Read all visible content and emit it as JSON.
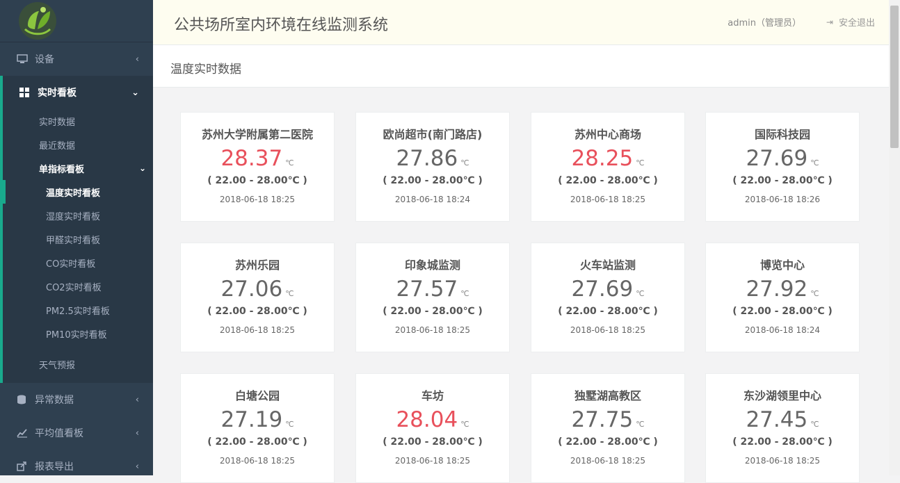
{
  "header": {
    "title": "公共场所室内环境在线监测系统",
    "user": "admin（管理员）",
    "logout": "安全退出"
  },
  "page": {
    "heading": "温度实时数据"
  },
  "sidebar": {
    "devices": "设备",
    "realtime_board": "实时看板",
    "realtime_data": "实时数据",
    "recent_data": "最近数据",
    "single_board": "单指标看板",
    "third": [
      "温度实时看板",
      "湿度实时看板",
      "甲醛实时看板",
      "CO实时看板",
      "CO2实时看板",
      "PM2.5实时看板",
      "PM10实时看板"
    ],
    "weather": "天气预报",
    "abnormal": "异常数据",
    "average": "平均值看板",
    "export": "报表导出"
  },
  "cards": [
    {
      "name": "苏州大学附属第二医院",
      "value": "28.37",
      "unit": "℃",
      "range": "( 22.00 - 28.00℃ )",
      "time": "2018-06-18 18:25",
      "alert": true
    },
    {
      "name": "欧尚超市(南门路店)",
      "value": "27.86",
      "unit": "℃",
      "range": "( 22.00 - 28.00℃ )",
      "time": "2018-06-18 18:24",
      "alert": false
    },
    {
      "name": "苏州中心商场",
      "value": "28.25",
      "unit": "℃",
      "range": "( 22.00 - 28.00℃ )",
      "time": "2018-06-18 18:25",
      "alert": true
    },
    {
      "name": "国际科技园",
      "value": "27.69",
      "unit": "℃",
      "range": "( 22.00 - 28.00℃ )",
      "time": "2018-06-18 18:26",
      "alert": false
    },
    {
      "name": "苏州乐园",
      "value": "27.06",
      "unit": "℃",
      "range": "( 22.00 - 28.00℃ )",
      "time": "2018-06-18 18:25",
      "alert": false
    },
    {
      "name": "印象城监测",
      "value": "27.57",
      "unit": "℃",
      "range": "( 22.00 - 28.00℃ )",
      "time": "2018-06-18 18:25",
      "alert": false
    },
    {
      "name": "火车站监测",
      "value": "27.69",
      "unit": "℃",
      "range": "( 22.00 - 28.00℃ )",
      "time": "2018-06-18 18:25",
      "alert": false
    },
    {
      "name": "博览中心",
      "value": "27.92",
      "unit": "℃",
      "range": "( 22.00 - 28.00℃ )",
      "time": "2018-06-18 18:24",
      "alert": false
    },
    {
      "name": "白塘公园",
      "value": "27.19",
      "unit": "℃",
      "range": "( 22.00 - 28.00℃ )",
      "time": "2018-06-18 18:25",
      "alert": false
    },
    {
      "name": "车坊",
      "value": "28.04",
      "unit": "℃",
      "range": "( 22.00 - 28.00℃ )",
      "time": "2018-06-18 18:25",
      "alert": true
    },
    {
      "name": "独墅湖高教区",
      "value": "27.75",
      "unit": "℃",
      "range": "( 22.00 - 28.00℃ )",
      "time": "2018-06-18 18:25",
      "alert": false
    },
    {
      "name": "东沙湖领里中心",
      "value": "27.45",
      "unit": "℃",
      "range": "( 22.00 - 28.00℃ )",
      "time": "2018-06-18 18:25",
      "alert": false
    }
  ],
  "colors": {
    "sidebar": "#2f4050",
    "accent": "#19aa8d",
    "alert": "#e8505b"
  }
}
